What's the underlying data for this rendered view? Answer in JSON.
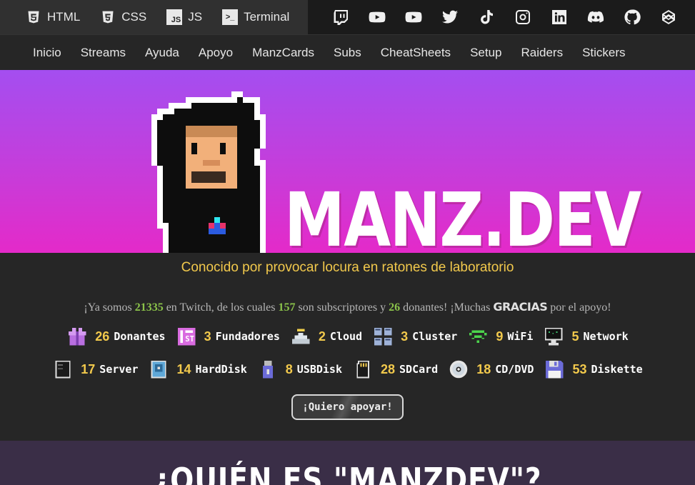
{
  "topbar": {
    "links": [
      {
        "label": "HTML",
        "icon": "html5-icon"
      },
      {
        "label": "CSS",
        "icon": "css3-icon"
      },
      {
        "label": "JS",
        "icon": "js-icon",
        "glyph": "JS"
      },
      {
        "label": "Terminal",
        "icon": "terminal-icon",
        "glyph": ">_"
      }
    ],
    "social": [
      "twitch-icon",
      "youtube-icon",
      "youtube-icon",
      "twitter-icon",
      "tiktok-icon",
      "instagram-icon",
      "linkedin-icon",
      "discord-icon",
      "github-icon",
      "codepen-icon"
    ]
  },
  "nav": [
    "Inicio",
    "Streams",
    "Ayuda",
    "Apoyo",
    "ManzCards",
    "Subs",
    "CheatSheets",
    "Setup",
    "Raiders",
    "Stickers"
  ],
  "hero": {
    "logo": "MANZ.DEV"
  },
  "slogan": "Conocido por provocar locura en ratones de laboratorio",
  "stats": {
    "p1": "¡Ya somos ",
    "total": "21335",
    "p2": " en Twitch, de los cuales ",
    "subs": "157",
    "p3": " son subscriptores y ",
    "donors": "26",
    "p4": " donantes! ¡Muchas ",
    "thanks": "GRACIAS",
    "p5": " por el apoyo!"
  },
  "badges_row1": [
    {
      "n": "26",
      "label": "Donantes",
      "icon": "gift-icon",
      "color": "#c27be6"
    },
    {
      "n": "3",
      "label": "Fundadores",
      "icon": "first-icon",
      "color": "#d96ce0"
    },
    {
      "n": "2",
      "label": "Cloud",
      "icon": "cloud-icon",
      "color": "#cfd8e0"
    },
    {
      "n": "3",
      "label": "Cluster",
      "icon": "cluster-icon",
      "color": "#9fb3d8"
    },
    {
      "n": "9",
      "label": "WiFi",
      "icon": "wifi-icon",
      "color": "#4cd44c"
    },
    {
      "n": "5",
      "label": "Network",
      "icon": "network-icon",
      "color": "#3bbf6b"
    }
  ],
  "badges_row2": [
    {
      "n": "17",
      "label": "Server",
      "icon": "server-icon",
      "color": "#3a3a3a"
    },
    {
      "n": "14",
      "label": "HardDisk",
      "icon": "harddisk-icon",
      "color": "#5fa8d8"
    },
    {
      "n": "8",
      "label": "USBDisk",
      "icon": "usb-icon",
      "color": "#7a7ad8"
    },
    {
      "n": "28",
      "label": "SDCard",
      "icon": "sdcard-icon",
      "color": "#444"
    },
    {
      "n": "18",
      "label": "CD/DVD",
      "icon": "cd-icon",
      "color": "#d8d8d8"
    },
    {
      "n": "53",
      "label": "Diskette",
      "icon": "diskette-icon",
      "color": "#6b6bd8"
    }
  ],
  "cta": "¡Quiero apoyar!",
  "section_title": "¿QUIÉN ES \"MANZDEV\"?"
}
